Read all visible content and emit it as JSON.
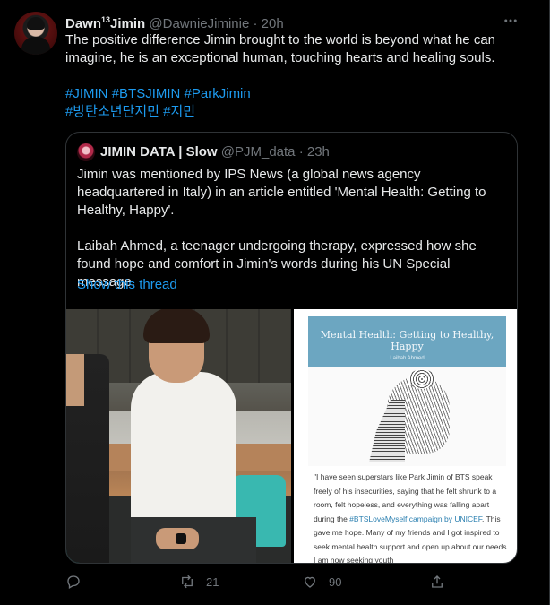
{
  "tweet": {
    "display_name": "Dawn",
    "display_name_sup": "13",
    "display_name_suffix": "Jimin",
    "handle": "@DawnieJiminie",
    "dot": "·",
    "time": "20h",
    "text": "The positive difference Jimin brought to the world is beyond what he can imagine, he is an exceptional human, touching hearts and healing souls.",
    "hashtags_line1": [
      "#JIMIN",
      "#BTSJIMIN",
      "#ParkJimin"
    ],
    "hashtags_line2": [
      "#방탄소년단지민",
      "#지민"
    ],
    "more_icon": "more-horizontal-icon"
  },
  "quote": {
    "display_name": "JIMIN DATA | Slow",
    "handle": "@PJM_data",
    "dot": "·",
    "time": "23h",
    "paragraph1": "Jimin was mentioned by IPS News (a global news agency headquartered in Italy) in an article entitled 'Mental Health: Getting to Healthy, Happy'.",
    "paragraph2": "Laibah Ahmed, a teenager undergoing therapy, expressed how she found hope and comfort in Jimin's words during his UN Special message.",
    "show_thread": "Show this thread",
    "article": {
      "title_line1": "Mental Health: Getting to Healthy,",
      "title_line2": "Happy",
      "author": "Laibah Ahmed",
      "body_1": "\"I have seen superstars like Park Jimin of BTS speak freely of his insecurities, saying that he felt shrunk to a room, felt hopeless, and everything was falling apart during the ",
      "body_link": "#BTSLoveMyself campaign by UNICEF",
      "body_2": ". This gave me hope. Many of my friends and I got inspired to seek mental health support and open up about our needs. I am now seeking youth"
    }
  },
  "actions": {
    "reply_count": "",
    "retweet_count": "21",
    "like_count": "90",
    "share_count": ""
  },
  "colors": {
    "background": "#000000",
    "text": "#e7e9ea",
    "muted": "#71767b",
    "link": "#1d9bf0",
    "border": "#2f3336"
  }
}
